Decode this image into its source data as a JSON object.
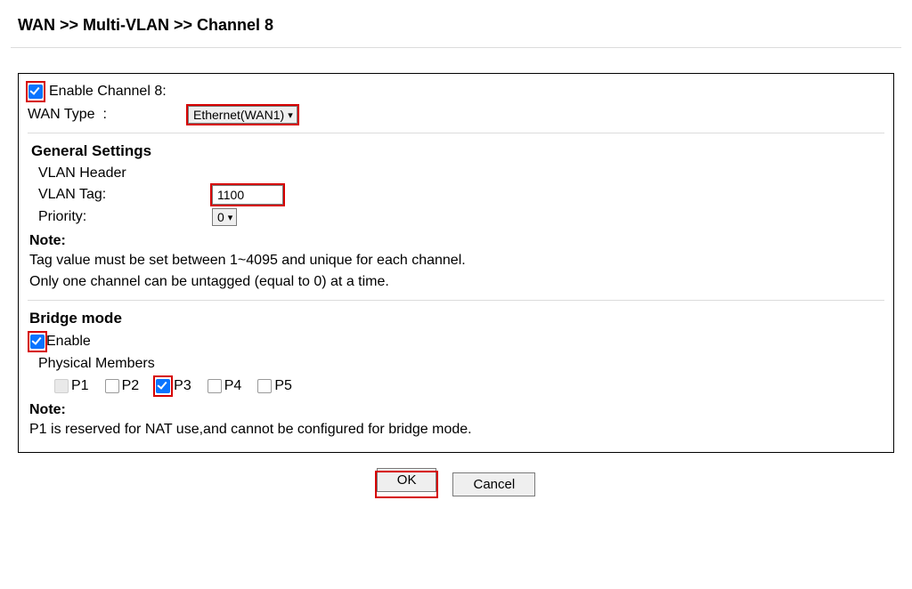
{
  "breadcrumb": "WAN >> Multi-VLAN >> Channel 8",
  "enable_channel": {
    "label": "Enable Channel 8:",
    "checked": true
  },
  "wan_type": {
    "label": "WAN Type  :",
    "value": "Ethernet(WAN1)"
  },
  "general": {
    "title": "General Settings",
    "vlan_header": "VLAN Header",
    "vlan_tag_label": "VLAN Tag:",
    "vlan_tag_value": "1100",
    "priority_label": "Priority:",
    "priority_value": "0"
  },
  "note1": {
    "title": "Note:",
    "line1": "Tag value must be set between 1~4095 and unique for each channel.",
    "line2": "Only one channel can be untagged (equal to 0) at a time."
  },
  "bridge": {
    "title": "Bridge mode",
    "enable_label": "Enable",
    "enable_checked": true,
    "members_label": "Physical Members",
    "ports": [
      {
        "label": "P1",
        "checked": false,
        "disabled": true,
        "highlight": false
      },
      {
        "label": "P2",
        "checked": false,
        "disabled": false,
        "highlight": false
      },
      {
        "label": "P3",
        "checked": true,
        "disabled": false,
        "highlight": true
      },
      {
        "label": "P4",
        "checked": false,
        "disabled": false,
        "highlight": false
      },
      {
        "label": "P5",
        "checked": false,
        "disabled": false,
        "highlight": false
      }
    ]
  },
  "note2": {
    "title": "Note:",
    "line1": "P1 is reserved for NAT use,and cannot be configured for bridge mode."
  },
  "buttons": {
    "ok": "OK",
    "cancel": "Cancel"
  }
}
